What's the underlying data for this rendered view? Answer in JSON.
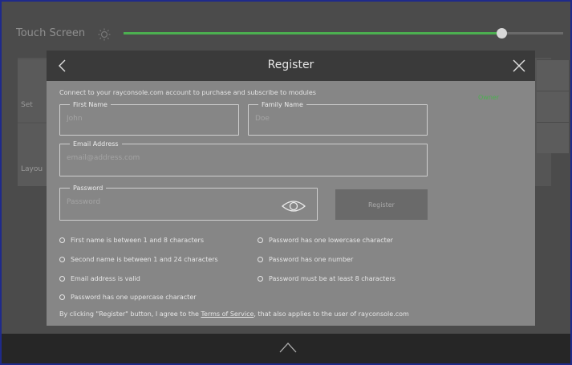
{
  "app": {
    "touch_screen_label": "Touch Screen",
    "brightness_fraction": 0.86,
    "accent_color": "#4caf50",
    "tiles": [
      {
        "label": "Set",
        "icon": "puzzle-icon"
      },
      {
        "label": "Layou",
        "icon": "layout-icon"
      }
    ]
  },
  "modal": {
    "title": "Register",
    "subtitle": "Connect to your rayconsole.com account to purchase and subscribe to modules",
    "owner_label": "Owner",
    "first_name": {
      "legend": "First Name",
      "placeholder": "John",
      "value": ""
    },
    "family_name": {
      "legend": "Family Name",
      "placeholder": "Doe",
      "value": ""
    },
    "email": {
      "legend": "Email Address",
      "placeholder": "email@address.com",
      "value": ""
    },
    "password": {
      "legend": "Password",
      "placeholder": "Password",
      "value": ""
    },
    "register_button": "Register",
    "requirements": [
      "First name is between 1 and 8 characters",
      "Second name is between 1 and 24 characters",
      "Email address is valid",
      "Password has one uppercase character",
      "Password has one lowercase character",
      "Password has one number",
      "Password must be at least 8 characters"
    ],
    "tos_prefix": "By clicking \"Register\" button, I agree to the ",
    "tos_link": "Terms of Service",
    "tos_suffix": ", that also applies to the user of rayconsole.com"
  }
}
